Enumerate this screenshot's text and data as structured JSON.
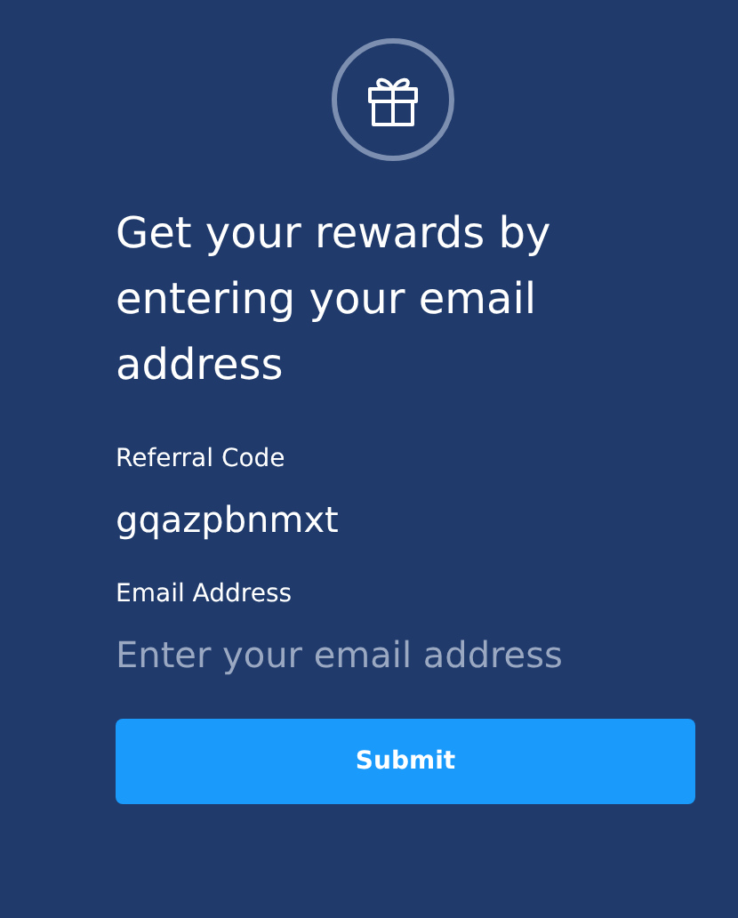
{
  "heading": "Get your rewards by entering your email address",
  "referral": {
    "label": "Referral Code",
    "value": "gqazpbnmxt"
  },
  "email": {
    "label": "Email Address",
    "placeholder": "Enter your email address"
  },
  "submit": {
    "label": "Submit"
  }
}
